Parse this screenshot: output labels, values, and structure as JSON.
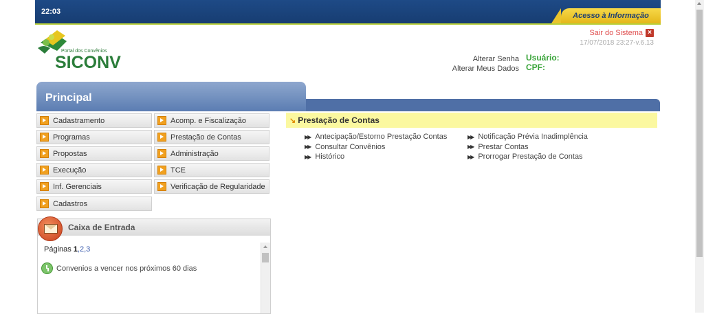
{
  "header": {
    "time": "22:03",
    "access_info": "Acesso à Informação",
    "logout": "Sair do Sistema",
    "datetime_version": "17/07/2018 23:27-v.6.13",
    "change_password": "Alterar Senha",
    "change_data": "Alterar Meus Dados",
    "user_label": "Usuário:",
    "cpf_label": "CPF:"
  },
  "logo": {
    "subtitle": "Portal dos Convênios",
    "title": "SICONV"
  },
  "principal": {
    "title": "Principal"
  },
  "menu": [
    {
      "label": "Cadastramento"
    },
    {
      "label": "Acomp. e Fiscalização"
    },
    {
      "label": "Programas"
    },
    {
      "label": "Prestação de Contas"
    },
    {
      "label": "Propostas"
    },
    {
      "label": "Administração"
    },
    {
      "label": "Execução"
    },
    {
      "label": "TCE"
    },
    {
      "label": "Inf. Gerenciais"
    },
    {
      "label": "Verificação de Regularidade"
    },
    {
      "label": "Cadastros"
    }
  ],
  "inbox": {
    "title": "Caixa de Entrada",
    "pages_label": "Páginas",
    "current_page": "1",
    "other_pages": ",2,3",
    "page2": "2",
    "page3": "3",
    "item": "Convenios a vencer nos próximos 60 dias"
  },
  "section": {
    "title": "Prestação de Contas",
    "col1": [
      {
        "label": "Antecipação/Estorno Prestação Contas"
      },
      {
        "label": "Consultar Convênios"
      },
      {
        "label": "Histórico"
      }
    ],
    "col2": [
      {
        "label": "Notificação Prévia Inadimplência"
      },
      {
        "label": "Prestar Contas"
      },
      {
        "label": "Prorrogar Prestação de Contas"
      }
    ]
  },
  "colors": {
    "topbar": "#1e4a86",
    "accent_yellow": "#f7d948",
    "brand_green": "#2b7d3a",
    "band_blue": "#4f6fa6",
    "section_highlight": "#fbf8a0",
    "menu_arrow": "#f0a020"
  }
}
